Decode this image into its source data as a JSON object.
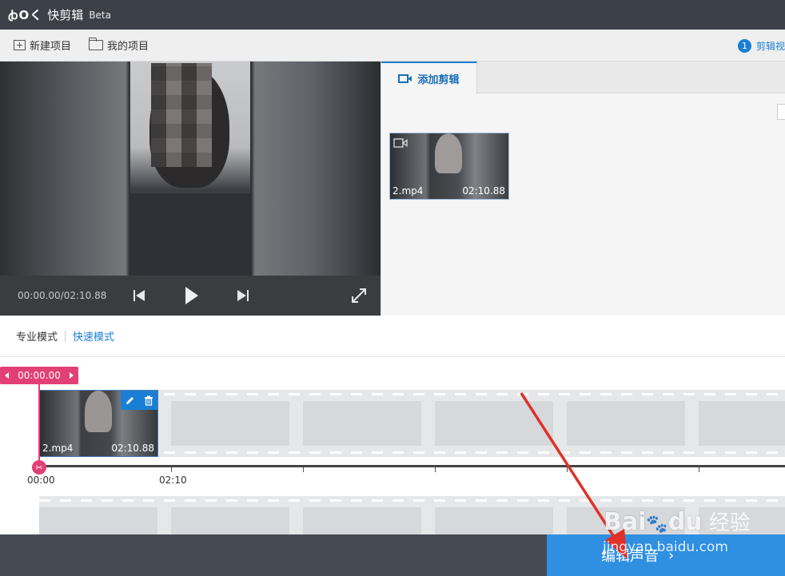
{
  "app": {
    "logo": "ꞗOく",
    "name": "快剪辑",
    "badge": "Beta"
  },
  "toolbar": {
    "new_project": "新建项目",
    "my_projects": "我的项目",
    "step_number": "1",
    "step_label": "剪辑视"
  },
  "player": {
    "time": "00:00.00/02:10.88"
  },
  "clip_panel": {
    "tab_label": "添加剪辑",
    "clips": [
      {
        "name": "2.mp4",
        "duration": "02:10.88"
      }
    ]
  },
  "modes": {
    "pro": "专业模式",
    "fast": "快速模式",
    "active": "fast"
  },
  "timeline": {
    "playhead": "00:00.00",
    "clip": {
      "name": "2.mp4",
      "duration": "02:10.88"
    },
    "ruler_labels": [
      "00:00",
      "02:10"
    ]
  },
  "bottom": {
    "edit_audio": "编辑声音",
    "arrow": "›"
  },
  "watermark": {
    "brand": "Bai",
    "brand2": "du",
    "cn": "经验",
    "url": "jingyan.baidu.com"
  },
  "colors": {
    "accent": "#1a7fd4",
    "playhead": "#e23f74",
    "titlebar": "#3c4049",
    "edit_button": "#2f8fe0"
  }
}
